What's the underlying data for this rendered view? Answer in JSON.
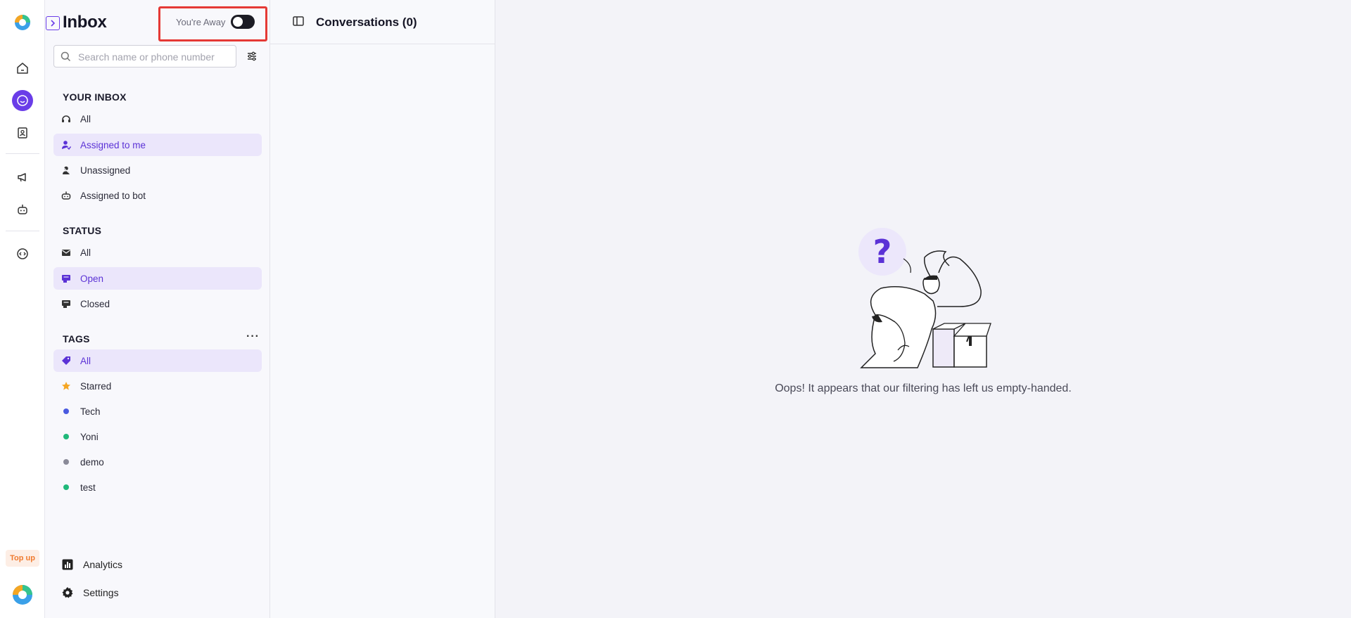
{
  "inbox": {
    "title": "Inbox",
    "away_label": "You're Away",
    "search_placeholder": "Search name or phone number",
    "sections": {
      "your_inbox": "YOUR INBOX",
      "status": "STATUS",
      "tags": "TAGS"
    },
    "your_inbox_items": [
      "All",
      "Assigned to me",
      "Unassigned",
      "Assigned to bot"
    ],
    "status_items": [
      "All",
      "Open",
      "Closed"
    ],
    "tags_items": [
      "All",
      "Starred",
      "Tech",
      "Yoni",
      "demo",
      "test"
    ],
    "bottom": {
      "analytics": "Analytics",
      "settings": "Settings"
    }
  },
  "rail": {
    "topup": "Top up"
  },
  "conversations": {
    "title": "Conversations (0)"
  },
  "main": {
    "empty_message": "Oops! It appears that our filtering has left us empty-handed."
  },
  "colors": {
    "accent": "#6a3de8",
    "tech": "#4a5ae0",
    "yoni": "#20b87a",
    "demo": "#8a8a98",
    "test": "#20b87a",
    "starred": "#f5a623",
    "highlight": "#e53935"
  }
}
